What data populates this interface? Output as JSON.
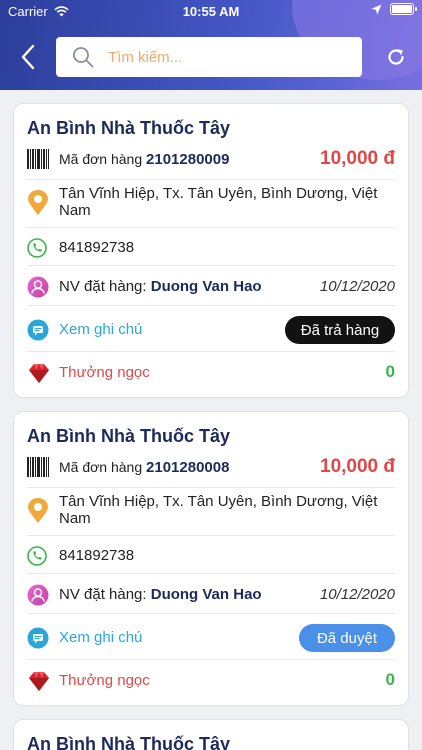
{
  "status_bar": {
    "carrier": "Carrier",
    "time": "10:55 AM"
  },
  "search": {
    "placeholder": "Tìm kiếm..."
  },
  "labels": {
    "order_code": "Mã đơn hàng",
    "staff": "NV đặt hàng:",
    "view_note": "Xem ghi chú",
    "reward": "Thưởng ngọc"
  },
  "colors": {
    "header": "#3d4fb8",
    "price": "#e04848",
    "reward_value": "#3cb44b",
    "status_returned": "#121212",
    "status_approved": "#4a8fe8"
  },
  "orders": [
    {
      "store": "An Bình Nhà Thuốc Tây",
      "order_id": "2101280009",
      "price": "10,000 đ",
      "address": "Tân Vĩnh Hiệp, Tx. Tân Uyên, Bình Dương, Việt Nam",
      "phone": "841892738",
      "staff_name": "Duong Van Hao",
      "date": "10/12/2020",
      "status": "Đã trả hàng",
      "reward": "0"
    },
    {
      "store": "An Bình Nhà Thuốc Tây",
      "order_id": "2101280008",
      "price": "10,000 đ",
      "address": "Tân Vĩnh Hiệp, Tx. Tân Uyên, Bình Dương, Việt Nam",
      "phone": "841892738",
      "staff_name": "Duong Van Hao",
      "date": "10/12/2020",
      "status": "Đã duyệt",
      "reward": "0"
    },
    {
      "store": "An Bình Nhà Thuốc Tây"
    }
  ]
}
